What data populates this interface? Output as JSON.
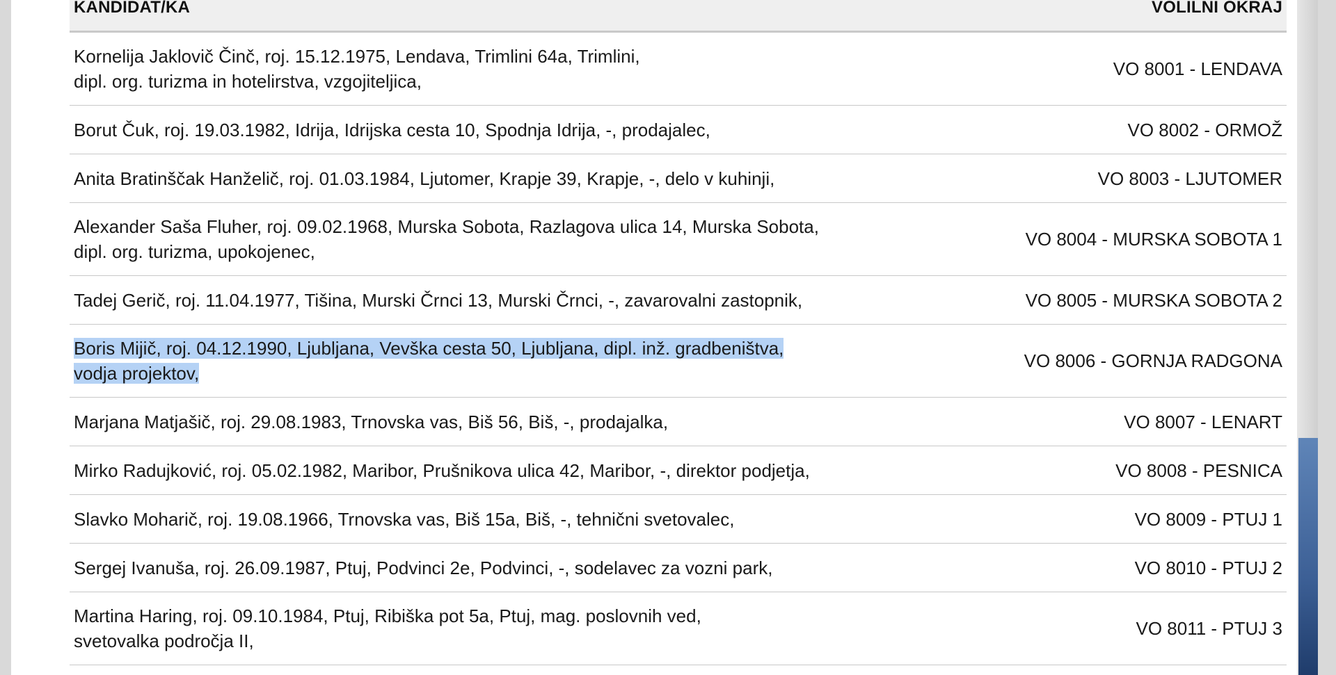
{
  "table": {
    "headers": {
      "candidate": "KANDIDAT/KA",
      "district": "VOLILNI OKRAJ"
    },
    "rows": [
      {
        "lines": [
          "Kornelija Jaklovič Činč, roj. 15.12.1975, Lendava, Trimlini 64a, Trimlini,",
          "dipl. org. turizma in hotelirstva, vzgojiteljica,"
        ],
        "district": "VO 8001 - LENDAVA"
      },
      {
        "lines": [
          "Borut Čuk, roj. 19.03.1982, Idrija, Idrijska cesta 10, Spodnja Idrija, -, prodajalec,"
        ],
        "district": "VO 8002 - ORMOŽ"
      },
      {
        "lines": [
          "Anita Bratinščak Hanželič, roj. 01.03.1984, Ljutomer, Krapje 39, Krapje, -, delo v kuhinji,"
        ],
        "district": "VO 8003 - LJUTOMER"
      },
      {
        "lines": [
          "Alexander Saša Fluher, roj. 09.02.1968, Murska Sobota, Razlagova ulica 14, Murska Sobota,",
          "dipl. org. turizma, upokojenec,"
        ],
        "district": "VO 8004 - MURSKA SOBOTA 1"
      },
      {
        "lines": [
          "Tadej Gerič, roj. 11.04.1977, Tišina, Murski Črnci 13, Murski Črnci, -, zavarovalni zastopnik,"
        ],
        "district": "VO 8005 - MURSKA SOBOTA 2"
      },
      {
        "lines": [
          "Boris Mijič, roj. 04.12.1990, Ljubljana, Vevška cesta 50, Ljubljana, dipl. inž. gradbeništva,",
          "vodja projektov,"
        ],
        "district": "VO 8006 - GORNJA RADGONA",
        "selected": true
      },
      {
        "lines": [
          "Marjana Matjašič, roj. 29.08.1983, Trnovska vas, Biš 56, Biš, -, prodajalka,"
        ],
        "district": "VO 8007 - LENART"
      },
      {
        "lines": [
          "Mirko Radujković, roj. 05.02.1982, Maribor, Prušnikova ulica 42, Maribor, -, direktor podjetja,"
        ],
        "district": "VO 8008 - PESNICA"
      },
      {
        "lines": [
          "Slavko Moharič, roj. 19.08.1966, Trnovska vas, Biš 15a, Biš, -, tehnični svetovalec,"
        ],
        "district": "VO 8009 - PTUJ 1"
      },
      {
        "lines": [
          "Sergej Ivanuša, roj. 26.09.1987, Ptuj, Podvinci 2e, Podvinci, -, sodelavec za vozni park,"
        ],
        "district": "VO 8010 - PTUJ 2"
      },
      {
        "lines": [
          "Martina Haring, roj. 09.10.1984, Ptuj, Ribiška pot 5a, Ptuj, mag. poslovnih ved,",
          "svetovalka področja II,"
        ],
        "district": "VO 8011 - PTUJ 3"
      }
    ]
  },
  "colors": {
    "selection": "#b5d2f5",
    "header_bg": "#efefef",
    "row_border": "#c8c8c8"
  }
}
